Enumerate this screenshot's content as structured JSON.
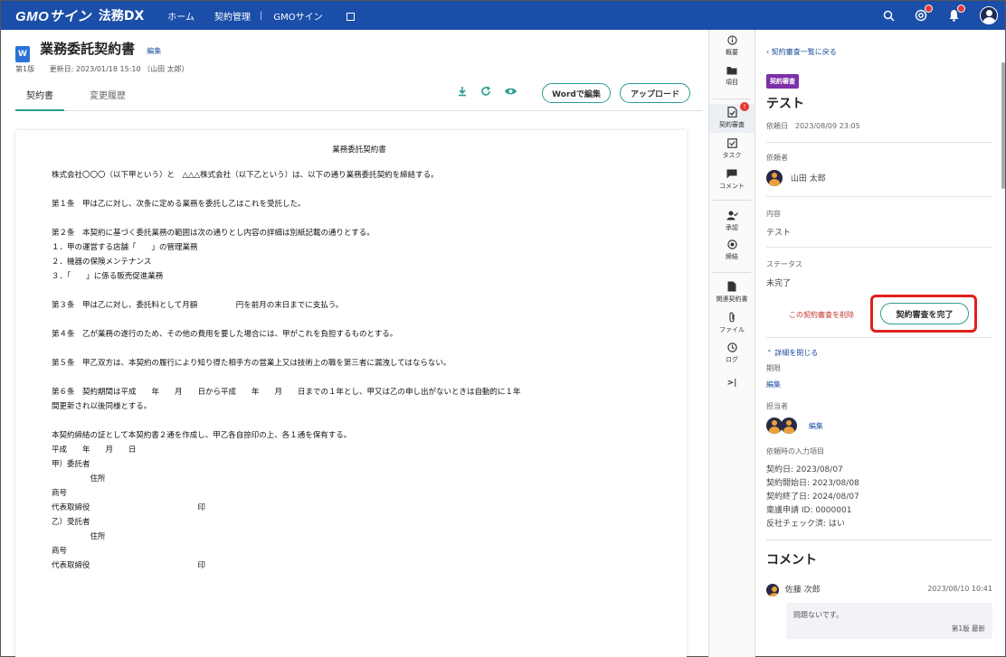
{
  "header": {
    "logo": "GMOサイン",
    "logo_sub": "法務DX",
    "nav": [
      "ホーム",
      "契約管理",
      "GMOサイン"
    ],
    "nav_sep": "|"
  },
  "document": {
    "title": "業務委託契約書",
    "edit_label": "編集",
    "version": "第1版",
    "updated": "更新日: 2023/01/18 15:10 （山田 太郎）",
    "tabs": [
      "契約書",
      "変更履歴"
    ],
    "word_edit_label": "Wordで編集",
    "upload_label": "アップロード",
    "body": {
      "heading": "業務委託契約書",
      "lines": [
        "株式会社〇〇〇（以下甲という）と　△△△株式会社（以下乙という）は、以下の通り業務委託契約を締結する。",
        "",
        "第１条　甲は乙に対し、次条に定める業務を委託し乙はこれを受託した。",
        "",
        "第２条　本契約に基づく委託業務の範囲は次の通りとし内容の詳細は別紙記載の通りとする。",
        "１．甲の運営する店舗「　　」の管理業務",
        "２．機器の保険メンテナンス",
        "３．「　　」に係る販売促進業務",
        "",
        "第３条　甲は乙に対し、委託料として月額　　　　　円を前月の末日までに支払う。",
        "",
        "第４条　乙が業務の遂行のため、その他の費用を要した場合には、甲がこれを負担するものとする。",
        "",
        "第５条　甲乙双方は、本契約の履行により知り得た相手方の営業上又は技術上の職を第三者に漏洩してはならない。",
        "",
        "第６条　契約期間は平成　　年　　月　　日から平成　　年　　月　　日までの１年とし、甲又は乙の申し出がないときは自動的に１年",
        "間更新され以後同様とする。",
        "",
        "本契約締結の証として本契約書２通を作成し、甲乙各自捺印の上、各１通を保有する。",
        "平成　　年　　月　　日",
        "甲）委託者",
        "　　　　　住所",
        "商号",
        "代表取締役　　　　　　　　　　　　　　印",
        "乙）受託者",
        "　　　　　住所",
        "商号",
        "代表取締役　　　　　　　　　　　　　　印"
      ]
    }
  },
  "sidebar_icons": [
    {
      "label": "概要",
      "icon": "info-icon"
    },
    {
      "label": "項目",
      "icon": "folder-icon"
    },
    {
      "label": "契約審査",
      "icon": "review-icon",
      "badge": "!"
    },
    {
      "label": "タスク",
      "icon": "task-icon"
    },
    {
      "label": "コメント",
      "icon": "comment-icon"
    },
    {
      "label": "承認",
      "icon": "approve-icon"
    },
    {
      "label": "締結",
      "icon": "sign-icon"
    },
    {
      "label": "関連契約書",
      "icon": "related-doc-icon"
    },
    {
      "label": "ファイル",
      "icon": "clip-icon"
    },
    {
      "label": "ログ",
      "icon": "clock-icon"
    },
    {
      "label": ">|",
      "icon": "collapse-icon"
    }
  ],
  "review": {
    "back_link": "契約審査一覧に戻る",
    "tag": "契約審査",
    "title": "テスト",
    "requested_date": "依頼日　2023/08/09 23:05",
    "requester_label": "依頼者",
    "requester_name": "山田 太郎",
    "content_label": "内容",
    "content_value": "テスト",
    "status_label": "ステータス",
    "status_value": "未完了",
    "delete_label": "この契約審査を削除",
    "complete_label": "契約審査を完了",
    "collapse_label": "詳細を閉じる",
    "due_label": "期限",
    "due_value": "編集",
    "assignee_label": "担当者",
    "assignee_edit": "編集",
    "input_items_label": "依頼時の入力項目",
    "input_items": [
      "契約日: 2023/08/07",
      "契約開始日: 2023/08/08",
      "契約終了日: 2024/08/07",
      "稟議申請 ID: 0000001",
      "反社チェック済: はい"
    ],
    "comment_heading": "コメント",
    "comment": {
      "author": "佐藤 次郎",
      "time": "2023/08/10 10:41",
      "text": "問題ないです。",
      "version": "第1版",
      "latest": "最新"
    }
  }
}
